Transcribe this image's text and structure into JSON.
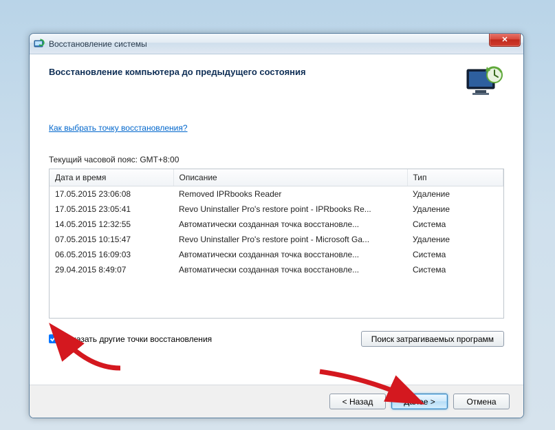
{
  "window": {
    "title": "Восстановление системы"
  },
  "header": {
    "heading": "Восстановление компьютера до предыдущего состояния",
    "help_link": "Как выбрать точку восстановления?",
    "timezone": "Текущий часовой пояс: GMT+8:00"
  },
  "table": {
    "columns": {
      "date": "Дата и время",
      "desc": "Описание",
      "type": "Тип"
    },
    "rows": [
      {
        "date": "17.05.2015 23:06:08",
        "desc": "Removed IPRbooks Reader",
        "type": "Удаление"
      },
      {
        "date": "17.05.2015 23:05:41",
        "desc": "Revo Uninstaller Pro's restore point - IPRbooks Re...",
        "type": "Удаление"
      },
      {
        "date": "14.05.2015 12:32:55",
        "desc": "Автоматически созданная точка восстановле...",
        "type": "Система"
      },
      {
        "date": "07.05.2015 10:15:47",
        "desc": "Revo Uninstaller Pro's restore point - Microsoft Ga...",
        "type": "Удаление"
      },
      {
        "date": "06.05.2015 16:09:03",
        "desc": "Автоматически созданная точка восстановле...",
        "type": "Система"
      },
      {
        "date": "29.04.2015 8:49:07",
        "desc": "Автоматически созданная точка восстановле...",
        "type": "Система"
      }
    ]
  },
  "checkbox": {
    "label": "Показать другие точки восстановления",
    "checked": true
  },
  "buttons": {
    "search_affected": "Поиск затрагиваемых программ",
    "back": "< Назад",
    "next": "Далее >",
    "cancel": "Отмена"
  }
}
